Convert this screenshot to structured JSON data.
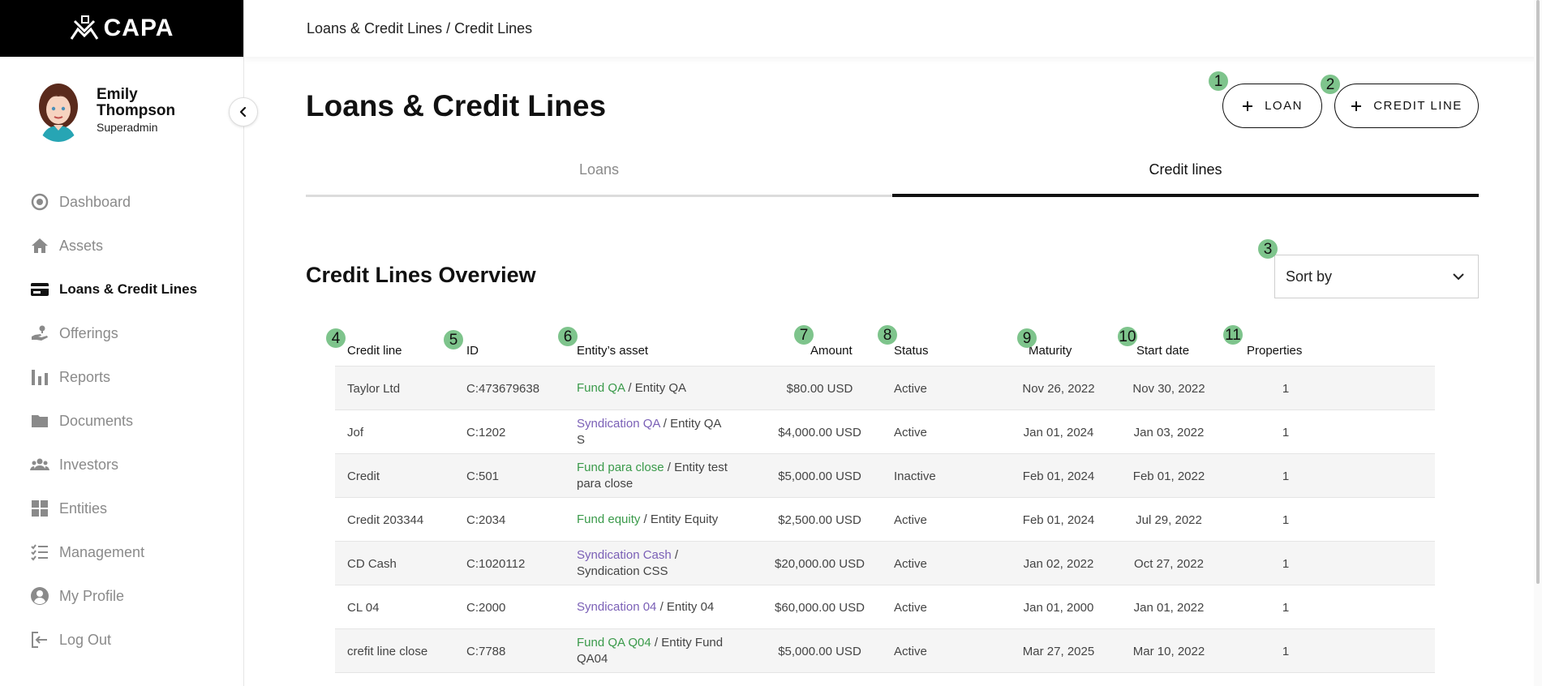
{
  "app": {
    "logo_text": "CAPA"
  },
  "breadcrumb": "Loans & Credit Lines / Credit Lines",
  "profile": {
    "name": "Emily Thompson",
    "role": "Superadmin"
  },
  "nav": [
    {
      "label": "Dashboard",
      "icon": "dashboard-icon"
    },
    {
      "label": "Assets",
      "icon": "home-icon"
    },
    {
      "label": "Loans & Credit Lines",
      "icon": "credit-card-icon",
      "active": true
    },
    {
      "label": "Offerings",
      "icon": "hand-money-icon"
    },
    {
      "label": "Reports",
      "icon": "bar-chart-icon"
    },
    {
      "label": "Documents",
      "icon": "folder-icon"
    },
    {
      "label": "Investors",
      "icon": "people-icon"
    },
    {
      "label": "Entities",
      "icon": "grid-icon"
    },
    {
      "label": "Management",
      "icon": "checklist-icon"
    },
    {
      "label": "My Profile",
      "icon": "account-icon"
    },
    {
      "label": "Log Out",
      "icon": "logout-icon"
    }
  ],
  "page": {
    "title": "Loans & Credit Lines",
    "loan_button": "LOAN",
    "credit_line_button": "CREDIT LINE"
  },
  "tabs": [
    {
      "label": "Loans",
      "active": false
    },
    {
      "label": "Credit lines",
      "active": true
    }
  ],
  "section": {
    "title": "Credit Lines Overview",
    "sort_placeholder": "Sort by"
  },
  "table": {
    "headers": [
      "Credit line",
      "ID",
      "Entity’s asset",
      "Amount",
      "Status",
      "Maturity",
      "Start date",
      "Properties"
    ],
    "rows": [
      {
        "credit_line": "Taylor Ltd",
        "id": "C:473679638",
        "asset_link": "Fund QA",
        "asset_link_type": "fund",
        "entity": " / Entity QA",
        "amount": "$80.00 USD",
        "status": "Active",
        "maturity": "Nov 26, 2022",
        "start_date": "Nov 30, 2022",
        "properties": "1"
      },
      {
        "credit_line": "Jof",
        "id": "C:1202",
        "asset_link": "Syndication QA",
        "asset_link_type": "syndication",
        "entity": " / Entity QA S",
        "amount": "$4,000.00 USD",
        "status": "Active",
        "maturity": "Jan 01, 2024",
        "start_date": "Jan 03, 2022",
        "properties": "1"
      },
      {
        "credit_line": "Credit",
        "id": "C:501",
        "asset_link": "Fund para close",
        "asset_link_type": "fund",
        "entity": " / Entity test para close",
        "amount": "$5,000.00 USD",
        "status": "Inactive",
        "maturity": "Feb 01, 2024",
        "start_date": "Feb 01, 2022",
        "properties": "1"
      },
      {
        "credit_line": "Credit 203344",
        "id": "C:2034",
        "asset_link": "Fund equity",
        "asset_link_type": "fund",
        "entity": " / Entity Equity",
        "amount": "$2,500.00 USD",
        "status": "Active",
        "maturity": "Feb 01, 2024",
        "start_date": "Jul 29, 2022",
        "properties": "1"
      },
      {
        "credit_line": "CD Cash",
        "id": "C:1020112",
        "asset_link": "Syndication Cash",
        "asset_link_type": "syndication",
        "entity": " / Syndication CSS",
        "amount": "$20,000.00 USD",
        "status": "Active",
        "maturity": "Jan 02, 2022",
        "start_date": "Oct 27, 2022",
        "properties": "1"
      },
      {
        "credit_line": "CL 04",
        "id": "C:2000",
        "asset_link": "Syndication 04",
        "asset_link_type": "syndication",
        "entity": " / Entity 04",
        "amount": "$60,000.00 USD",
        "status": "Active",
        "maturity": "Jan 01, 2000",
        "start_date": "Jan 01, 2022",
        "properties": "1"
      },
      {
        "credit_line": "crefit line close",
        "id": "C:7788",
        "asset_link": "Fund QA Q04",
        "asset_link_type": "fund",
        "entity": " / Entity Fund QA04",
        "amount": "$5,000.00 USD",
        "status": "Active",
        "maturity": "Mar 27, 2025",
        "start_date": "Mar 10, 2022",
        "properties": "1"
      }
    ]
  },
  "markers": [
    "1",
    "2",
    "3",
    "4",
    "5",
    "6",
    "7",
    "8",
    "9",
    "10",
    "11"
  ],
  "colors": {
    "fund_link": "#3a9a4a",
    "syndication_link": "#7a5fb6",
    "marker": "#7ec48c",
    "logo_bar": "#000000"
  }
}
